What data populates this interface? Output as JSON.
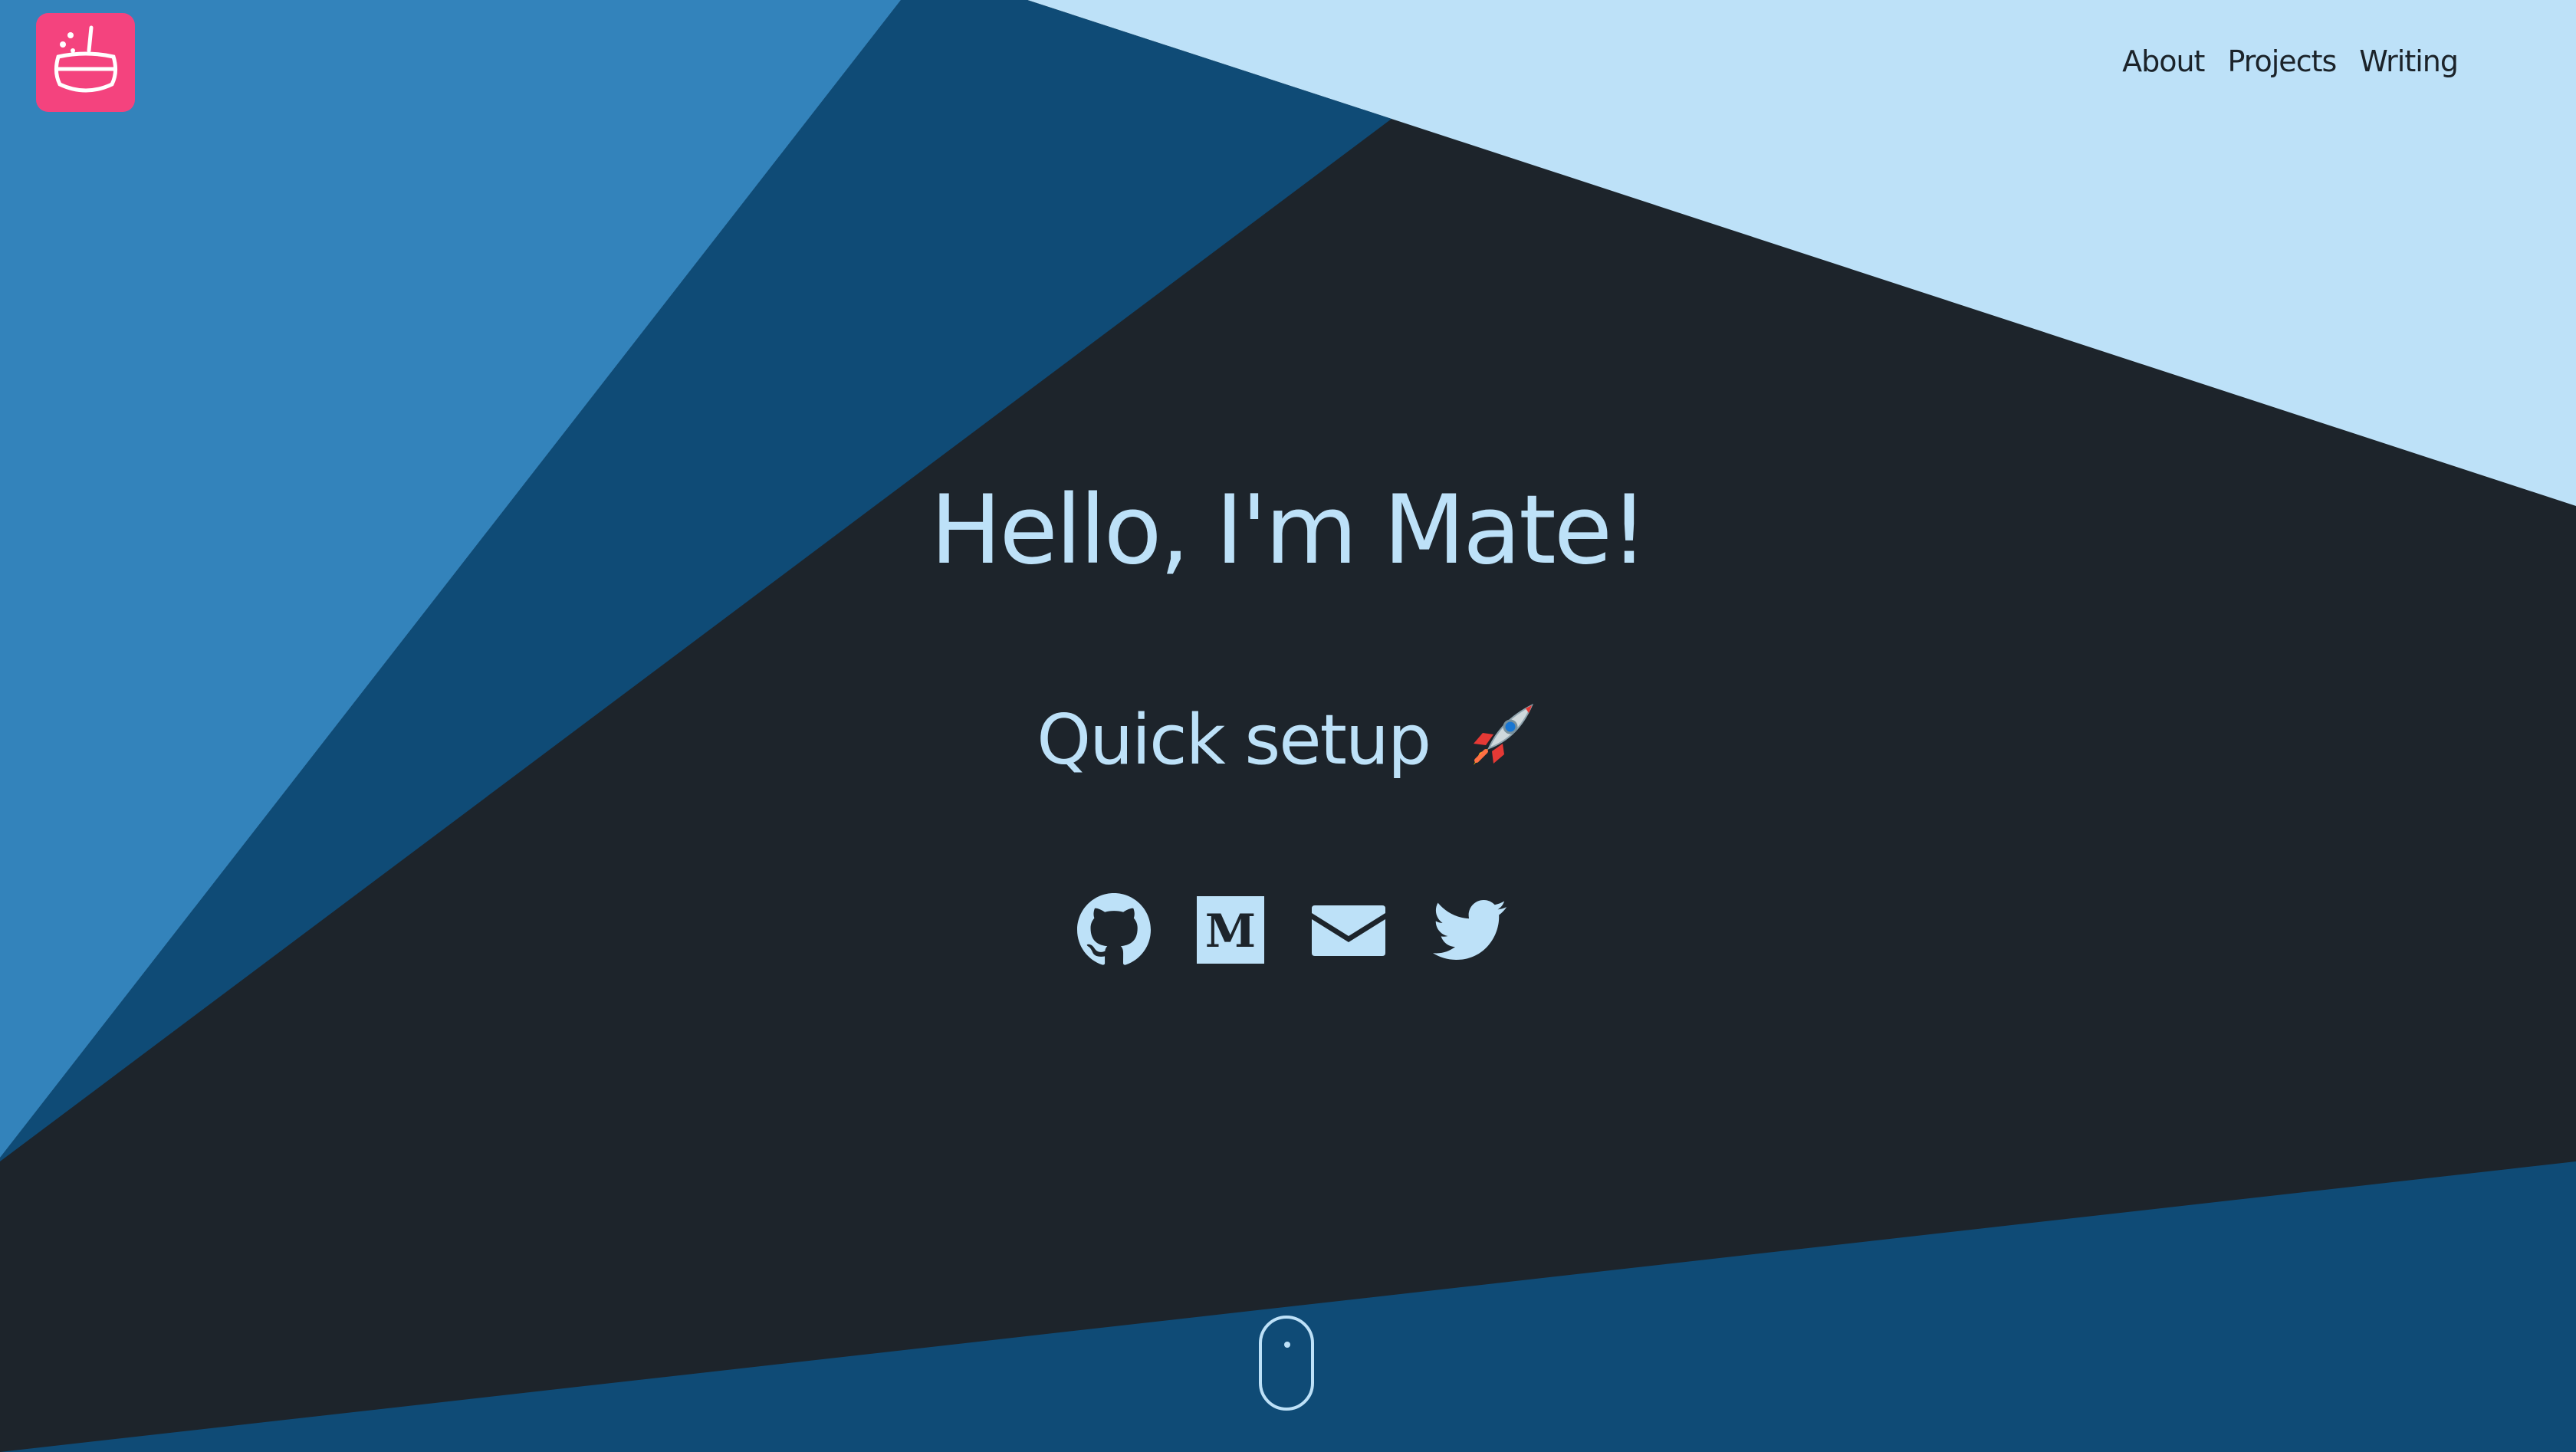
{
  "brand": {
    "logo_icon": "cauldron-icon",
    "accent": "#f4437e"
  },
  "nav": {
    "about": "About",
    "projects": "Projects",
    "writing": "Writing"
  },
  "hero": {
    "title": "Hello, I'm Mate!",
    "subtitle": "Quick setup",
    "emoji_icon": "rocket-icon"
  },
  "socials": [
    {
      "icon": "github-icon"
    },
    {
      "icon": "medium-icon"
    },
    {
      "icon": "email-icon"
    },
    {
      "icon": "twitter-icon"
    }
  ],
  "scroll_indicator": {
    "icon": "mouse-scroll-icon"
  },
  "colors": {
    "dark": "#1d242b",
    "navy": "#0f4b76",
    "mid_blue": "#3383bb",
    "light_blue": "#bde1f8",
    "text_light": "#bde1f8",
    "text_dark": "#1b232a"
  }
}
